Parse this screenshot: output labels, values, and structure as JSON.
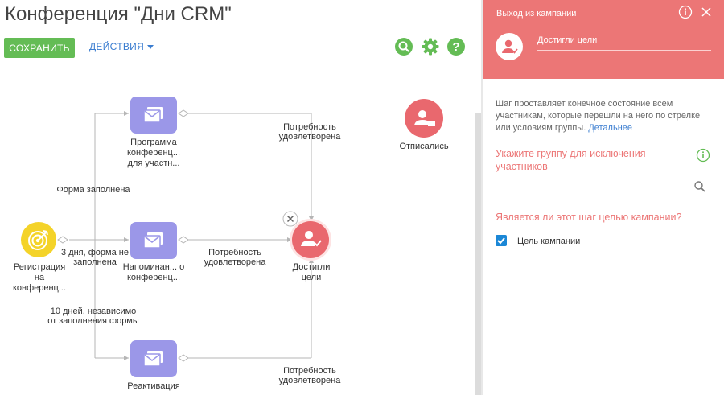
{
  "header": {
    "title": "Конференция \"Дни CRM\""
  },
  "toolbar": {
    "save_label": "СОХРАНИТЬ",
    "actions_label": "ДЕЙСТВИЯ"
  },
  "colors": {
    "save": "#64bc55",
    "accent": "#3b7dd0",
    "node_purple": "#9b97e8",
    "node_red": "#e9686e",
    "node_yellow": "#f4d329",
    "panel_head": "#ec7676"
  },
  "flow": {
    "nodes": {
      "registration": "Регистрация на конференц...",
      "program": "Программа конференц... для участн...",
      "reminder": "Напоминан... о конференц...",
      "reactivation": "Реактивация",
      "reached_goal": "Достигли цели",
      "unsubscribed": "Отписались"
    },
    "connections": {
      "form_filled": "Форма заполнена",
      "three_days": "3 дня, форма не заполнена",
      "ten_days": "10 дней, независимо от заполнения формы",
      "need_top": "Потребность удовлетворена",
      "need_mid": "Потребность удовлетворена",
      "need_bottom": "Потребность удовлетворена"
    }
  },
  "panel": {
    "title": "Выход из кампании",
    "name_value": "Достигли цели",
    "description": "Шаг проставляет конечное состояние всем участникам, которые перешли на него по стрелке или условиям группы.",
    "details_link": "Детальнее",
    "exclude_group_label": "Укажите группу для исключения участников",
    "exclude_group_value": "",
    "goal_question": "Является ли этот шаг целью кампании?",
    "goal_checkbox_label": "Цель кампании",
    "goal_checked": true
  }
}
